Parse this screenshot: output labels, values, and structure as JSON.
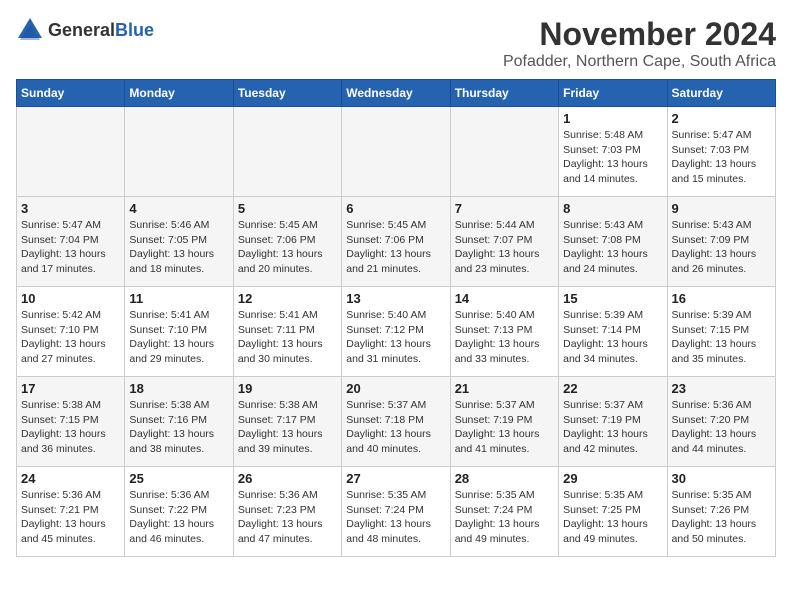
{
  "header": {
    "logo_general": "General",
    "logo_blue": "Blue",
    "main_title": "November 2024",
    "subtitle": "Pofadder, Northern Cape, South Africa"
  },
  "weekdays": [
    "Sunday",
    "Monday",
    "Tuesday",
    "Wednesday",
    "Thursday",
    "Friday",
    "Saturday"
  ],
  "weeks": [
    [
      {
        "day": "",
        "info": "",
        "empty": true
      },
      {
        "day": "",
        "info": "",
        "empty": true
      },
      {
        "day": "",
        "info": "",
        "empty": true
      },
      {
        "day": "",
        "info": "",
        "empty": true
      },
      {
        "day": "",
        "info": "",
        "empty": true
      },
      {
        "day": "1",
        "info": "Sunrise: 5:48 AM\nSunset: 7:03 PM\nDaylight: 13 hours\nand 14 minutes."
      },
      {
        "day": "2",
        "info": "Sunrise: 5:47 AM\nSunset: 7:03 PM\nDaylight: 13 hours\nand 15 minutes."
      }
    ],
    [
      {
        "day": "3",
        "info": "Sunrise: 5:47 AM\nSunset: 7:04 PM\nDaylight: 13 hours\nand 17 minutes."
      },
      {
        "day": "4",
        "info": "Sunrise: 5:46 AM\nSunset: 7:05 PM\nDaylight: 13 hours\nand 18 minutes."
      },
      {
        "day": "5",
        "info": "Sunrise: 5:45 AM\nSunset: 7:06 PM\nDaylight: 13 hours\nand 20 minutes."
      },
      {
        "day": "6",
        "info": "Sunrise: 5:45 AM\nSunset: 7:06 PM\nDaylight: 13 hours\nand 21 minutes."
      },
      {
        "day": "7",
        "info": "Sunrise: 5:44 AM\nSunset: 7:07 PM\nDaylight: 13 hours\nand 23 minutes."
      },
      {
        "day": "8",
        "info": "Sunrise: 5:43 AM\nSunset: 7:08 PM\nDaylight: 13 hours\nand 24 minutes."
      },
      {
        "day": "9",
        "info": "Sunrise: 5:43 AM\nSunset: 7:09 PM\nDaylight: 13 hours\nand 26 minutes."
      }
    ],
    [
      {
        "day": "10",
        "info": "Sunrise: 5:42 AM\nSunset: 7:10 PM\nDaylight: 13 hours\nand 27 minutes."
      },
      {
        "day": "11",
        "info": "Sunrise: 5:41 AM\nSunset: 7:10 PM\nDaylight: 13 hours\nand 29 minutes."
      },
      {
        "day": "12",
        "info": "Sunrise: 5:41 AM\nSunset: 7:11 PM\nDaylight: 13 hours\nand 30 minutes."
      },
      {
        "day": "13",
        "info": "Sunrise: 5:40 AM\nSunset: 7:12 PM\nDaylight: 13 hours\nand 31 minutes."
      },
      {
        "day": "14",
        "info": "Sunrise: 5:40 AM\nSunset: 7:13 PM\nDaylight: 13 hours\nand 33 minutes."
      },
      {
        "day": "15",
        "info": "Sunrise: 5:39 AM\nSunset: 7:14 PM\nDaylight: 13 hours\nand 34 minutes."
      },
      {
        "day": "16",
        "info": "Sunrise: 5:39 AM\nSunset: 7:15 PM\nDaylight: 13 hours\nand 35 minutes."
      }
    ],
    [
      {
        "day": "17",
        "info": "Sunrise: 5:38 AM\nSunset: 7:15 PM\nDaylight: 13 hours\nand 36 minutes."
      },
      {
        "day": "18",
        "info": "Sunrise: 5:38 AM\nSunset: 7:16 PM\nDaylight: 13 hours\nand 38 minutes."
      },
      {
        "day": "19",
        "info": "Sunrise: 5:38 AM\nSunset: 7:17 PM\nDaylight: 13 hours\nand 39 minutes."
      },
      {
        "day": "20",
        "info": "Sunrise: 5:37 AM\nSunset: 7:18 PM\nDaylight: 13 hours\nand 40 minutes."
      },
      {
        "day": "21",
        "info": "Sunrise: 5:37 AM\nSunset: 7:19 PM\nDaylight: 13 hours\nand 41 minutes."
      },
      {
        "day": "22",
        "info": "Sunrise: 5:37 AM\nSunset: 7:19 PM\nDaylight: 13 hours\nand 42 minutes."
      },
      {
        "day": "23",
        "info": "Sunrise: 5:36 AM\nSunset: 7:20 PM\nDaylight: 13 hours\nand 44 minutes."
      }
    ],
    [
      {
        "day": "24",
        "info": "Sunrise: 5:36 AM\nSunset: 7:21 PM\nDaylight: 13 hours\nand 45 minutes."
      },
      {
        "day": "25",
        "info": "Sunrise: 5:36 AM\nSunset: 7:22 PM\nDaylight: 13 hours\nand 46 minutes."
      },
      {
        "day": "26",
        "info": "Sunrise: 5:36 AM\nSunset: 7:23 PM\nDaylight: 13 hours\nand 47 minutes."
      },
      {
        "day": "27",
        "info": "Sunrise: 5:35 AM\nSunset: 7:24 PM\nDaylight: 13 hours\nand 48 minutes."
      },
      {
        "day": "28",
        "info": "Sunrise: 5:35 AM\nSunset: 7:24 PM\nDaylight: 13 hours\nand 49 minutes."
      },
      {
        "day": "29",
        "info": "Sunrise: 5:35 AM\nSunset: 7:25 PM\nDaylight: 13 hours\nand 49 minutes."
      },
      {
        "day": "30",
        "info": "Sunrise: 5:35 AM\nSunset: 7:26 PM\nDaylight: 13 hours\nand 50 minutes."
      }
    ]
  ]
}
